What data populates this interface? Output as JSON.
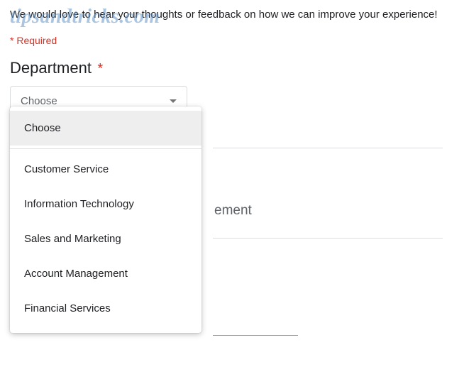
{
  "form": {
    "description": "We would love to hear your thoughts or feedback on how we can improve your experience!",
    "required_note": "* Required",
    "watermark": "tipsandtricks.com"
  },
  "question": {
    "label": "Department",
    "asterisk": "*",
    "selected": "Choose"
  },
  "dropdown": {
    "options": [
      "Choose",
      "Customer Service",
      "Information Technology",
      "Sales and Marketing",
      "Account Management",
      "Financial Services"
    ]
  },
  "behind": {
    "partial_text": "ement"
  }
}
